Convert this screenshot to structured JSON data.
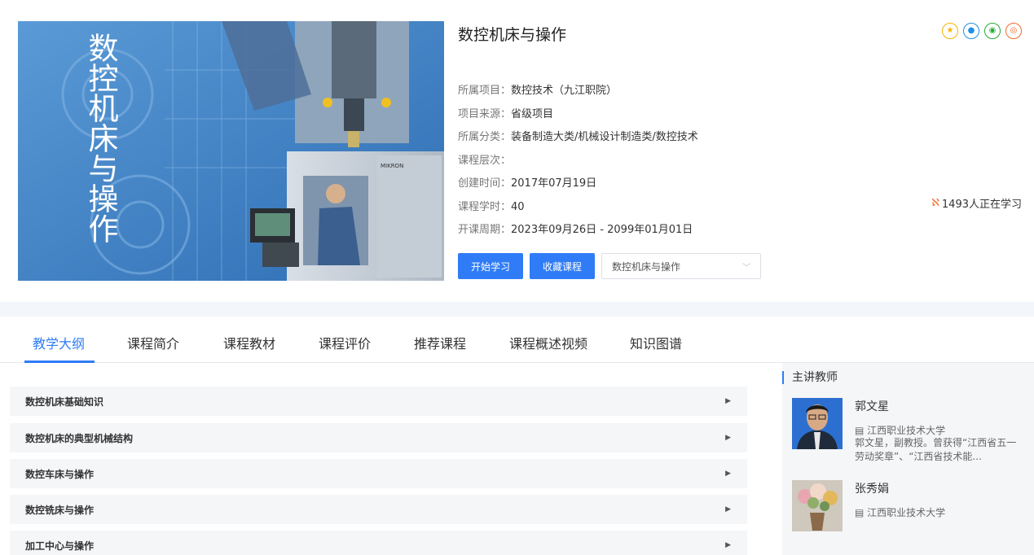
{
  "cover": {
    "title": "数控机床与操作",
    "brand_label": "MIKRON"
  },
  "course": {
    "title": "数控机床与操作",
    "meta": [
      {
        "key": "所属项目：",
        "value": "数控技术（九江职院）"
      },
      {
        "key": "项目来源：",
        "value": "省级项目"
      },
      {
        "key": "所属分类：",
        "value": "装备制造大类/机械设计制造类/数控技术"
      },
      {
        "key": "课程层次：",
        "value": ""
      },
      {
        "key": "创建时间：",
        "value": "2017年07月19日"
      },
      {
        "key": "课程学时：",
        "value": "40"
      },
      {
        "key": "开课周期：",
        "value": "2023年09月26日 - 2099年01月01日"
      }
    ],
    "learners": "1493人正在学习",
    "share_icons": [
      "qzone-icon",
      "qq-icon",
      "wechat-icon",
      "weibo-icon"
    ]
  },
  "actions": {
    "start_label": "开始学习",
    "collect_label": "收藏课程",
    "course_select_value": "数控机床与操作"
  },
  "tabs": [
    "教学大纲",
    "课程简介",
    "课程教材",
    "课程评价",
    "推荐课程",
    "课程概述视频",
    "知识图谱"
  ],
  "syllabus": [
    "数控机床基础知识",
    "数控机床的典型机械结构",
    "数控车床与操作",
    "数控铣床与操作",
    "加工中心与操作"
  ],
  "teachers_panel": {
    "title": "主讲教师",
    "teachers": [
      {
        "name": "郭文星",
        "school": "江西职业技术大学",
        "bio": "郭文星，副教授。曾获得“江西省五一劳动奖章”、“江西省技术能..."
      },
      {
        "name": "张秀娟",
        "school": "江西职业技术大学",
        "bio": ""
      }
    ]
  },
  "colors": {
    "accent": "#2f7cf6",
    "panel_bg": "#f5f6f8"
  }
}
